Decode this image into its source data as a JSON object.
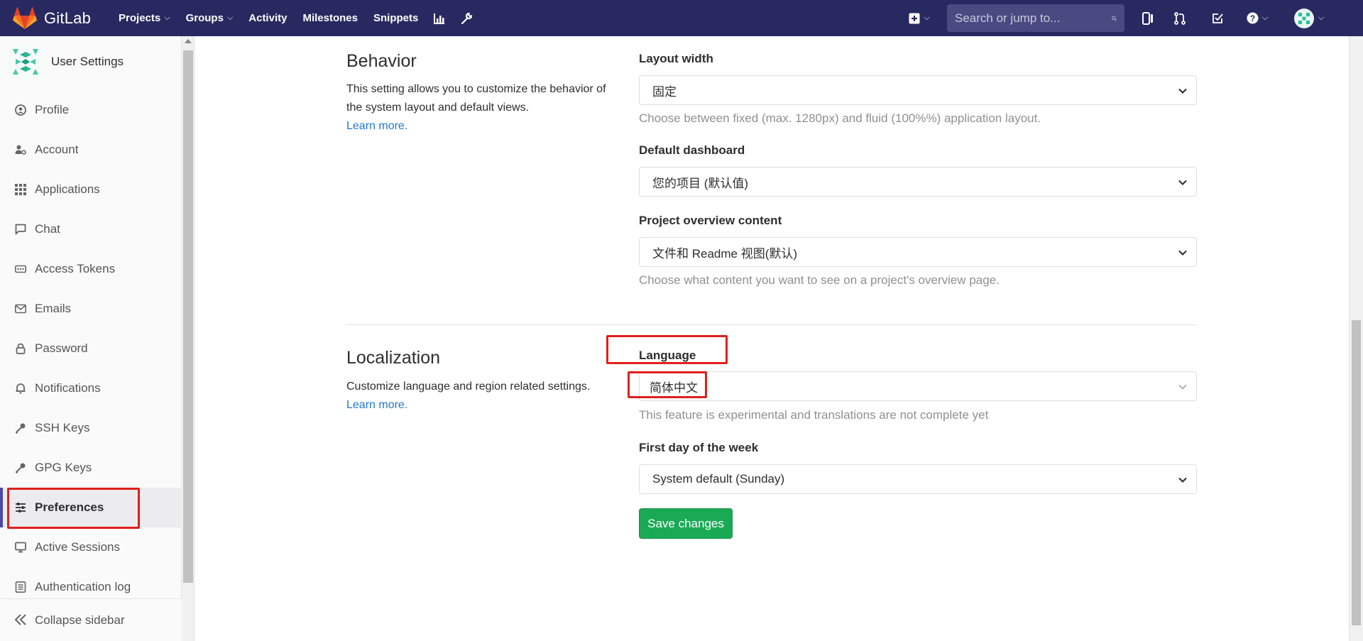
{
  "navbar": {
    "brand": "GitLab",
    "links": [
      {
        "label": "Projects",
        "dropdown": true
      },
      {
        "label": "Groups",
        "dropdown": true
      },
      {
        "label": "Activity",
        "dropdown": false
      },
      {
        "label": "Milestones",
        "dropdown": false
      },
      {
        "label": "Snippets",
        "dropdown": false
      }
    ],
    "search_placeholder": "Search or jump to..."
  },
  "sidebar": {
    "title": "User Settings",
    "items": [
      {
        "label": "Profile",
        "icon": "profile-icon"
      },
      {
        "label": "Account",
        "icon": "account-icon"
      },
      {
        "label": "Applications",
        "icon": "applications-icon"
      },
      {
        "label": "Chat",
        "icon": "chat-icon"
      },
      {
        "label": "Access Tokens",
        "icon": "access-tokens-icon"
      },
      {
        "label": "Emails",
        "icon": "emails-icon"
      },
      {
        "label": "Password",
        "icon": "password-icon"
      },
      {
        "label": "Notifications",
        "icon": "notifications-icon"
      },
      {
        "label": "SSH Keys",
        "icon": "ssh-keys-icon"
      },
      {
        "label": "GPG Keys",
        "icon": "gpg-keys-icon"
      },
      {
        "label": "Preferences",
        "icon": "preferences-icon",
        "active": true
      },
      {
        "label": "Active Sessions",
        "icon": "active-sessions-icon"
      },
      {
        "label": "Authentication log",
        "icon": "authentication-log-icon"
      }
    ],
    "collapse_label": "Collapse sidebar"
  },
  "behavior": {
    "title": "Behavior",
    "description": "This setting allows you to customize the behavior of the system layout and default views.",
    "learn_more": "Learn more.",
    "layout_width_label": "Layout width",
    "layout_width_value": "固定",
    "layout_width_help": "Choose between fixed (max. 1280px) and fluid (100%%) application layout.",
    "default_dashboard_label": "Default dashboard",
    "default_dashboard_value": "您的项目 (默认值)",
    "project_overview_label": "Project overview content",
    "project_overview_value": "文件和 Readme 视图(默认)",
    "project_overview_help": "Choose what content you want to see on a project's overview page."
  },
  "localization": {
    "title": "Localization",
    "description": "Customize language and region related settings.",
    "learn_more": "Learn more.",
    "language_label": "Language",
    "language_value": "简体中文",
    "language_help": "This feature is experimental and translations are not complete yet",
    "first_day_label": "First day of the week",
    "first_day_value": "System default (Sunday)"
  },
  "save_button": "Save changes",
  "colors": {
    "navbar": "#292961",
    "accent": "#4b4ba3",
    "save": "#1aaa55",
    "link": "#1f78d1",
    "annotation": "#e0201b"
  }
}
